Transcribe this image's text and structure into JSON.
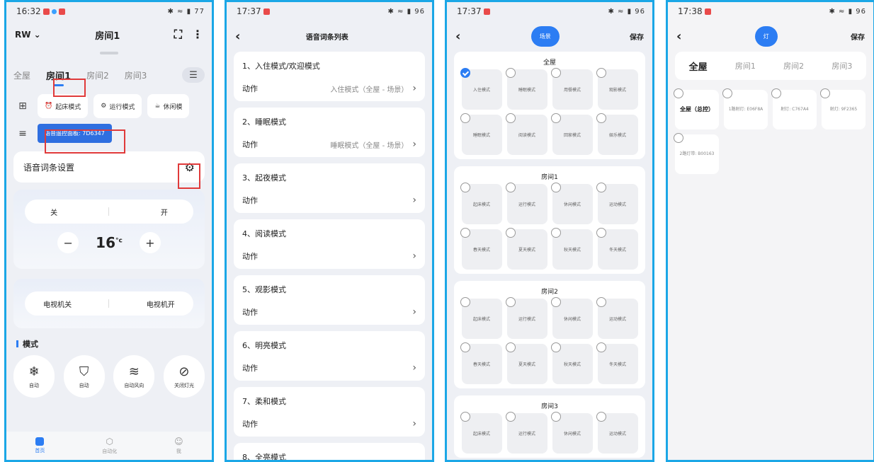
{
  "phone1": {
    "time": "16:32",
    "battery": "77",
    "account": "RW",
    "title": "房间1",
    "rooms": [
      "全屋",
      "房间1",
      "房间2",
      "房间3"
    ],
    "mode_chips": [
      "起床模式",
      "运行模式",
      "休闲模"
    ],
    "panel_badge": "语音遥控面板: 7D6347",
    "voice_settings": "语音词条设置",
    "ac": {
      "off": "关",
      "on": "开",
      "temp": "16",
      "unit": "°c",
      "minus": "−",
      "plus": "+"
    },
    "tv": {
      "off": "电视机关",
      "on": "电视机开"
    },
    "modes_title": "模式",
    "bubbles": [
      "自动",
      "自动",
      "自动风向",
      "关闭灯光"
    ],
    "tabs": [
      "首页",
      "自动化",
      "我"
    ]
  },
  "phone2": {
    "time": "17:37",
    "battery": "96",
    "title": "语音词条列表",
    "entries": [
      {
        "title": "1、入住模式/欢迎模式",
        "label": "动作",
        "value": "入住模式（全屋 - 场景）"
      },
      {
        "title": "2、睡眠模式",
        "label": "动作",
        "value": "睡眠模式（全屋 - 场景）"
      },
      {
        "title": "3、起夜模式",
        "label": "动作",
        "value": ""
      },
      {
        "title": "4、阅读模式",
        "label": "动作",
        "value": ""
      },
      {
        "title": "5、观影模式",
        "label": "动作",
        "value": ""
      },
      {
        "title": "6、明亮模式",
        "label": "动作",
        "value": ""
      },
      {
        "title": "7、柔和模式",
        "label": "动作",
        "value": ""
      },
      {
        "title": "8、全亮模式",
        "label": "",
        "value": ""
      }
    ]
  },
  "phone3": {
    "time": "17:37",
    "battery": "96",
    "tag": "场景",
    "save": "保存",
    "blocks": [
      {
        "title": "全屋",
        "cells": [
          "入住模式",
          "睡眠模式",
          "用餐模式",
          "观影模式",
          "睡眠模式",
          "阅读模式",
          "回家模式",
          "娱乐模式"
        ],
        "checked": 0
      },
      {
        "title": "房间1",
        "cells": [
          "起床模式",
          "运行模式",
          "休闲模式",
          "运动模式",
          "春天模式",
          "夏天模式",
          "秋天模式",
          "冬天模式"
        ],
        "checked": -1
      },
      {
        "title": "房间2",
        "cells": [
          "起床模式",
          "运行模式",
          "休闲模式",
          "运动模式",
          "春天模式",
          "夏天模式",
          "秋天模式",
          "冬天模式"
        ],
        "checked": -1
      },
      {
        "title": "房间3",
        "cells": [
          "起床模式",
          "运行模式",
          "休闲模式",
          "运动模式"
        ],
        "checked": -1
      }
    ]
  },
  "phone4": {
    "time": "17:38",
    "battery": "96",
    "tag": "灯",
    "save": "保存",
    "rooms": [
      "全屋",
      "房间1",
      "房间2",
      "房间3"
    ],
    "devices": [
      "全屋（总控）",
      "1路射灯: E06F8A",
      "射灯: C767A4",
      "射灯: 9F2365",
      "2路灯带: B00163"
    ]
  }
}
